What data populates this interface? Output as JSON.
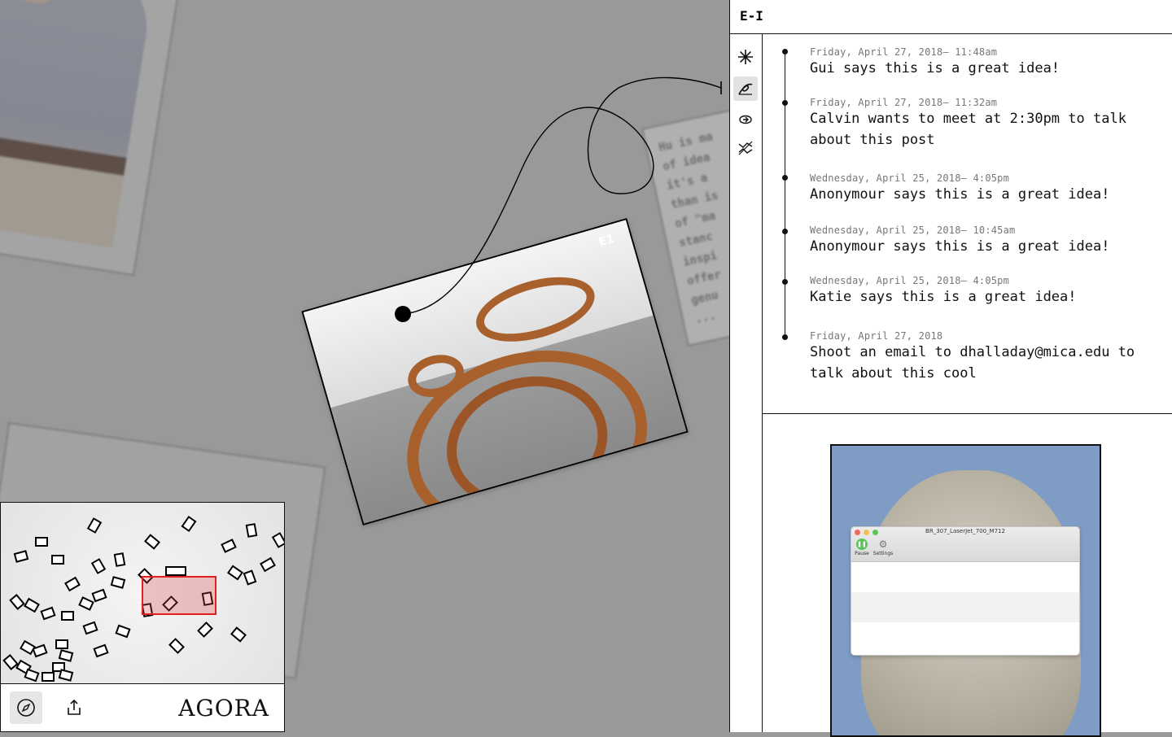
{
  "app": {
    "name": "AGORA",
    "logo_glyph": "E-I"
  },
  "canvas": {
    "photo_mark": "E1",
    "background_note_text": "Hu is ma\nof idea\nit's a \nthan is\nof \"ma\nstanc\ninspi\noffer\ngenu\n..."
  },
  "minimap": {
    "toolbar": {
      "explore_icon": "compass-icon",
      "share_icon": "upload-icon",
      "brand": "AGORA"
    }
  },
  "rail": {
    "items": [
      {
        "name": "asterisk-icon",
        "active": false
      },
      {
        "name": "link-loop-icon",
        "active": true
      },
      {
        "name": "loop-arrows-icon",
        "active": false
      },
      {
        "name": "zigzag-arrows-icon",
        "active": false
      }
    ]
  },
  "feed": {
    "entries": [
      {
        "date": "Friday, April 27, 2018– 11:48am",
        "message": "Gui says this is a great idea!"
      },
      {
        "date": "Friday, April 27, 2018– 11:32am",
        "message": "Calvin wants to meet at 2:30pm to talk about this post"
      },
      {
        "date": "Wednesday, April 25, 2018– 4:05pm",
        "message": "Anonymour says this is a great idea!"
      },
      {
        "date": "Wednesday, April 25, 2018– 10:45am",
        "message": "Anonymour says this is a great idea!"
      },
      {
        "date": "Wednesday, April 25, 2018– 4:05pm",
        "message": "Katie says this is a great idea!"
      },
      {
        "date": "Friday, April 27, 2018",
        "message": "Shoot an email to dhalladay@mica.edu to talk about this cool"
      }
    ]
  },
  "preview": {
    "window_title": "BR_307_LaserJet_700_M712",
    "pause_label": "Pause",
    "settings_label": "Settings"
  },
  "colors": {
    "canvas_bg": "#999999",
    "viewport_fill": "#e03c3c",
    "rust": "#a8602d"
  }
}
